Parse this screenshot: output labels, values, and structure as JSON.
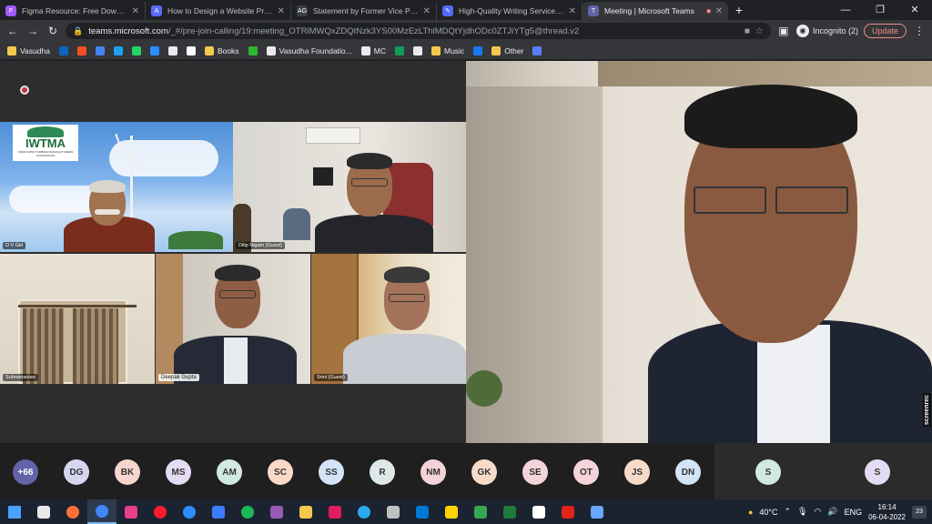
{
  "browser": {
    "tabs": [
      {
        "title": "Figma Resource: Free Download",
        "icon_color": "#a259ff",
        "icon": "figma-icon"
      },
      {
        "title": "How to Design a Website Prototy",
        "icon_color": "#5b6bff",
        "icon": "a-icon"
      },
      {
        "title": "Statement by Former Vice Presid",
        "icon_color": "#3c4043",
        "icon": "ag-icon"
      },
      {
        "title": "High-Quality Writing Services | F",
        "icon_color": "#4f6bff",
        "icon": "quill-icon"
      },
      {
        "title": "Meeting | Microsoft Teams",
        "icon_color": "#6264a7",
        "icon": "teams-icon"
      }
    ],
    "icon_letters": [
      "F",
      "A",
      "AG",
      "✎",
      "T"
    ],
    "url_host": "teams.microsoft.com",
    "url_path": "/_#/pre-join-calling/19:meeting_OTRlMWQxZDQtNzk3YS00MzEzLThlMDQtYjdhODc0ZTJiYTg5@thread.v2",
    "incognito_label": "Incognito (2)",
    "update_label": "Update",
    "win_controls": [
      "—",
      "❐",
      "✕"
    ]
  },
  "bookmarks": [
    {
      "label": "Vasudha",
      "color": "#f2c94c"
    },
    {
      "label": "",
      "color": "#0a66c2"
    },
    {
      "label": "",
      "color": "#f25022"
    },
    {
      "label": "",
      "color": "#4285f4"
    },
    {
      "label": "",
      "color": "#1da1f2"
    },
    {
      "label": "",
      "color": "#25d366"
    },
    {
      "label": "",
      "color": "#2d8cff"
    },
    {
      "label": "",
      "color": "#e8eaed"
    },
    {
      "label": "",
      "color": "#ffffff"
    },
    {
      "label": "Books",
      "color": "#f2c94c"
    },
    {
      "label": "",
      "color": "#2eb82e"
    },
    {
      "label": "Vasudha Foundatio...",
      "color": "#e8eaed"
    },
    {
      "label": "MC",
      "color": "#e8eaed"
    },
    {
      "label": "",
      "color": "#0f9d58"
    },
    {
      "label": "",
      "color": "#e8eaed"
    },
    {
      "label": "Music",
      "color": "#f2c94c"
    },
    {
      "label": "",
      "color": "#1877f2"
    },
    {
      "label": "Other",
      "color": "#f2c94c"
    },
    {
      "label": "",
      "color": "#5b7cff"
    }
  ],
  "meeting": {
    "participants_tiles": [
      {
        "name": "D V Giri"
      },
      {
        "name": "Dilip Nigam (Guest)"
      },
      {
        "name": "Subramanian"
      },
      {
        "name": "Deepak Gupta"
      },
      {
        "name": "Srini (Guest)"
      }
    ],
    "logo_text": "IWTMA",
    "logo_subtitle": "INDIAN WIND TURBINE MANUFACTURERS ASSOCIATION",
    "watermark": "screenrec",
    "roster": [
      {
        "initials": "+66",
        "color": "#6264a7",
        "text_color": "#ffffff"
      },
      {
        "initials": "DG",
        "color": "#d6d6ef",
        "text_color": "#333333"
      },
      {
        "initials": "BK",
        "color": "#f7d5cf",
        "text_color": "#333333"
      },
      {
        "initials": "MS",
        "color": "#e3dcf4",
        "text_color": "#333333"
      },
      {
        "initials": "AM",
        "color": "#d2e9e1",
        "text_color": "#333333"
      },
      {
        "initials": "SC",
        "color": "#fbd9c8",
        "text_color": "#333333"
      },
      {
        "initials": "SS",
        "color": "#d4e4f7",
        "text_color": "#333333"
      },
      {
        "initials": "R",
        "color": "#dfe8e8",
        "text_color": "#333333"
      },
      {
        "initials": "NM",
        "color": "#f4d3d9",
        "text_color": "#333333"
      },
      {
        "initials": "GK",
        "color": "#f7dbc9",
        "text_color": "#333333"
      },
      {
        "initials": "SE",
        "color": "#f4d3d9",
        "text_color": "#333333"
      },
      {
        "initials": "OT",
        "color": "#f4d3d9",
        "text_color": "#333333"
      },
      {
        "initials": "JS",
        "color": "#f7dbc9",
        "text_color": "#333333"
      },
      {
        "initials": "DN",
        "color": "#d4e4f7",
        "text_color": "#333333"
      },
      {
        "initials": "S",
        "color": "#d2e9e1",
        "text_color": "#333333"
      },
      {
        "initials": "S",
        "color": "#e3dcf4",
        "text_color": "#333333"
      }
    ]
  },
  "taskbar": {
    "apps": [
      {
        "icon": "windows-icon",
        "color": "#4aa3ff"
      },
      {
        "icon": "settings-icon",
        "color": "#e8e8e8"
      },
      {
        "icon": "firefox-icon",
        "color": "#ff7139"
      },
      {
        "icon": "chrome-icon",
        "color": "#4285f4"
      },
      {
        "icon": "bug-icon",
        "color": "#e83e8c"
      },
      {
        "icon": "opera-icon",
        "color": "#ff1b2d"
      },
      {
        "icon": "zoom-icon",
        "color": "#2d8cff"
      },
      {
        "icon": "notes-icon",
        "color": "#3d7bfd"
      },
      {
        "icon": "spotify-icon",
        "color": "#1db954"
      },
      {
        "icon": "winrar-icon",
        "color": "#9b59b6"
      },
      {
        "icon": "folder-icon",
        "color": "#f2c94c"
      },
      {
        "icon": "slack-icon",
        "color": "#e01e5a"
      },
      {
        "icon": "telegram-icon",
        "color": "#2aabee"
      },
      {
        "icon": "calculator-icon",
        "color": "#c0c0c0"
      },
      {
        "icon": "store-icon",
        "color": "#0078d4"
      },
      {
        "icon": "sticky-notes-icon",
        "color": "#ffd400"
      },
      {
        "icon": "downloads-icon",
        "color": "#36a852"
      },
      {
        "icon": "excel-icon",
        "color": "#1f7a3e"
      },
      {
        "icon": "cursor-icon",
        "color": "#ffffff"
      },
      {
        "icon": "acrobat-icon",
        "color": "#e2231a"
      },
      {
        "icon": "files-icon",
        "color": "#6aa7ff"
      }
    ],
    "weather": "40°C",
    "language": "ENG",
    "time": "16:14",
    "date": "06-04-2022",
    "notifications": "23"
  }
}
